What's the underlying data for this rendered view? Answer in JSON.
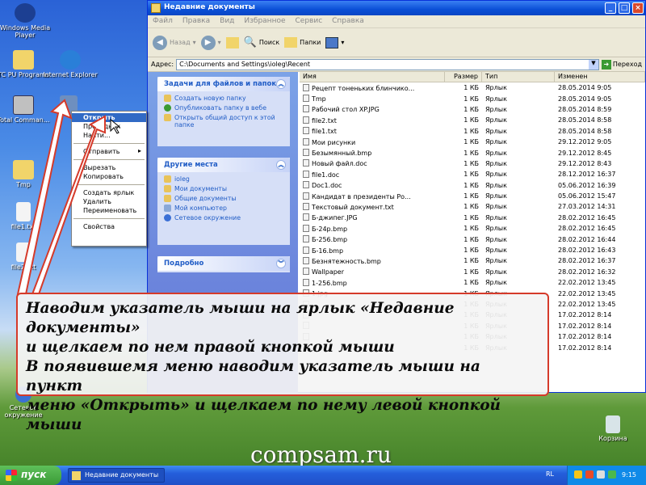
{
  "desktop": {
    "icons": [
      {
        "label": "Windows Media Player"
      },
      {
        "label": "TC PU Programs"
      },
      {
        "label": "Internet Explorer"
      },
      {
        "label": "Total Comman..."
      },
      {
        "label": "Tmp"
      },
      {
        "label": "file1.txt"
      },
      {
        "label": "file2.txt"
      },
      {
        "label": "Сетевое окружение"
      },
      {
        "label": "Корзина"
      }
    ]
  },
  "window": {
    "title": "Недавние документы",
    "menu": [
      "Файл",
      "Правка",
      "Вид",
      "Избранное",
      "Сервис",
      "Справка"
    ],
    "toolbar": {
      "back": "Назад",
      "search": "Поиск",
      "folders": "Папки"
    },
    "address_label": "Адрес:",
    "address": "C:\\Documents and Settings\\ioleg\\Recent",
    "go": "Переход"
  },
  "tasks": {
    "title": "Задачи для файлов и папок",
    "items": [
      "Создать новую папку",
      "Опубликовать папку в вебе",
      "Открыть общий доступ к этой папке"
    ]
  },
  "places": {
    "title": "Другие места",
    "items": [
      "ioleg",
      "Мои документы",
      "Общие документы",
      "Мой компьютер",
      "Сетевое окружение"
    ]
  },
  "details": {
    "title": "Подробно"
  },
  "columns": {
    "name": "Имя",
    "size": "Размер",
    "type": "Тип",
    "modified": "Изменен"
  },
  "files": [
    [
      "Рецепт тоненьких блинчико...",
      "1 КБ",
      "Ярлык",
      "28.05.2014 9:05"
    ],
    [
      "Tmp",
      "1 КБ",
      "Ярлык",
      "28.05.2014 9:05"
    ],
    [
      "Рабочий стол XP.JPG",
      "1 КБ",
      "Ярлык",
      "28.05.2014 8:59"
    ],
    [
      "file2.txt",
      "1 КБ",
      "Ярлык",
      "28.05.2014 8:58"
    ],
    [
      "file1.txt",
      "1 КБ",
      "Ярлык",
      "28.05.2014 8:58"
    ],
    [
      "Мои рисунки",
      "1 КБ",
      "Ярлык",
      "29.12.2012 9:05"
    ],
    [
      "Безымянный.bmp",
      "1 КБ",
      "Ярлык",
      "29.12.2012 8:45"
    ],
    [
      "Новый файл.doc",
      "1 КБ",
      "Ярлык",
      "29.12.2012 8:43"
    ],
    [
      "file1.doc",
      "1 КБ",
      "Ярлык",
      "28.12.2012 16:37"
    ],
    [
      "Doc1.doc",
      "1 КБ",
      "Ярлык",
      "05.06.2012 16:39"
    ],
    [
      "Кандидат в президенты Ро...",
      "1 КБ",
      "Ярлык",
      "05.06.2012 15:47"
    ],
    [
      "Текстовый документ.txt",
      "1 КБ",
      "Ярлык",
      "27.03.2012 14:31"
    ],
    [
      "Б-джипег.JPG",
      "1 КБ",
      "Ярлык",
      "28.02.2012 16:45"
    ],
    [
      "Б-24p.bmp",
      "1 КБ",
      "Ярлык",
      "28.02.2012 16:45"
    ],
    [
      "Б-256.bmp",
      "1 КБ",
      "Ярлык",
      "28.02.2012 16:44"
    ],
    [
      "Б-16.bmp",
      "1 КБ",
      "Ярлык",
      "28.02.2012 16:43"
    ],
    [
      "Безнятежность.bmp",
      "1 КБ",
      "Ярлык",
      "28.02.2012 16:37"
    ],
    [
      "Wallpaper",
      "1 КБ",
      "Ярлык",
      "28.02.2012 16:32"
    ],
    [
      "1-256.bmp",
      "1 КБ",
      "Ярлык",
      "22.02.2012 13:45"
    ],
    [
      "1.jpg",
      "1 КБ",
      "Ярлык",
      "22.02.2012 13:45"
    ],
    [
      "",
      "1 КБ",
      "Ярлык",
      "22.02.2012 13:45"
    ],
    [
      "",
      "1 КБ",
      "Ярлык",
      "17.02.2012 8:14"
    ],
    [
      "",
      "1 КБ",
      "Ярлык",
      "17.02.2012 8:14"
    ],
    [
      "",
      "1 КБ",
      "Ярлык",
      "17.02.2012 8:14"
    ],
    [
      "",
      "1 КБ",
      "Ярлык",
      "17.02.2012 8:14"
    ]
  ],
  "context_menu": {
    "items": [
      "Открыть",
      "Проводник",
      "Найти...",
      "Отправить",
      "Вырезать",
      "Копировать",
      "Создать ярлык",
      "Удалить",
      "Переименовать",
      "Свойства"
    ]
  },
  "callout": {
    "lines": [
      "Наводим указатель мыши на ярлык «Недавние документы»",
      "и щелкаем по нем правой кнопкой мыши",
      "В появившемя меню наводим указатель мыши на пункт",
      "меню «Открыть» и щелкаем по нему левой кнопкой мыши"
    ]
  },
  "watermark": "compsam.ru",
  "taskbar": {
    "start": "пуск",
    "task": "Недавние документы",
    "lang": "RL",
    "clock": "9:15"
  },
  "colors": {
    "accent": "#d53a2a",
    "selection": "#316ac5"
  }
}
